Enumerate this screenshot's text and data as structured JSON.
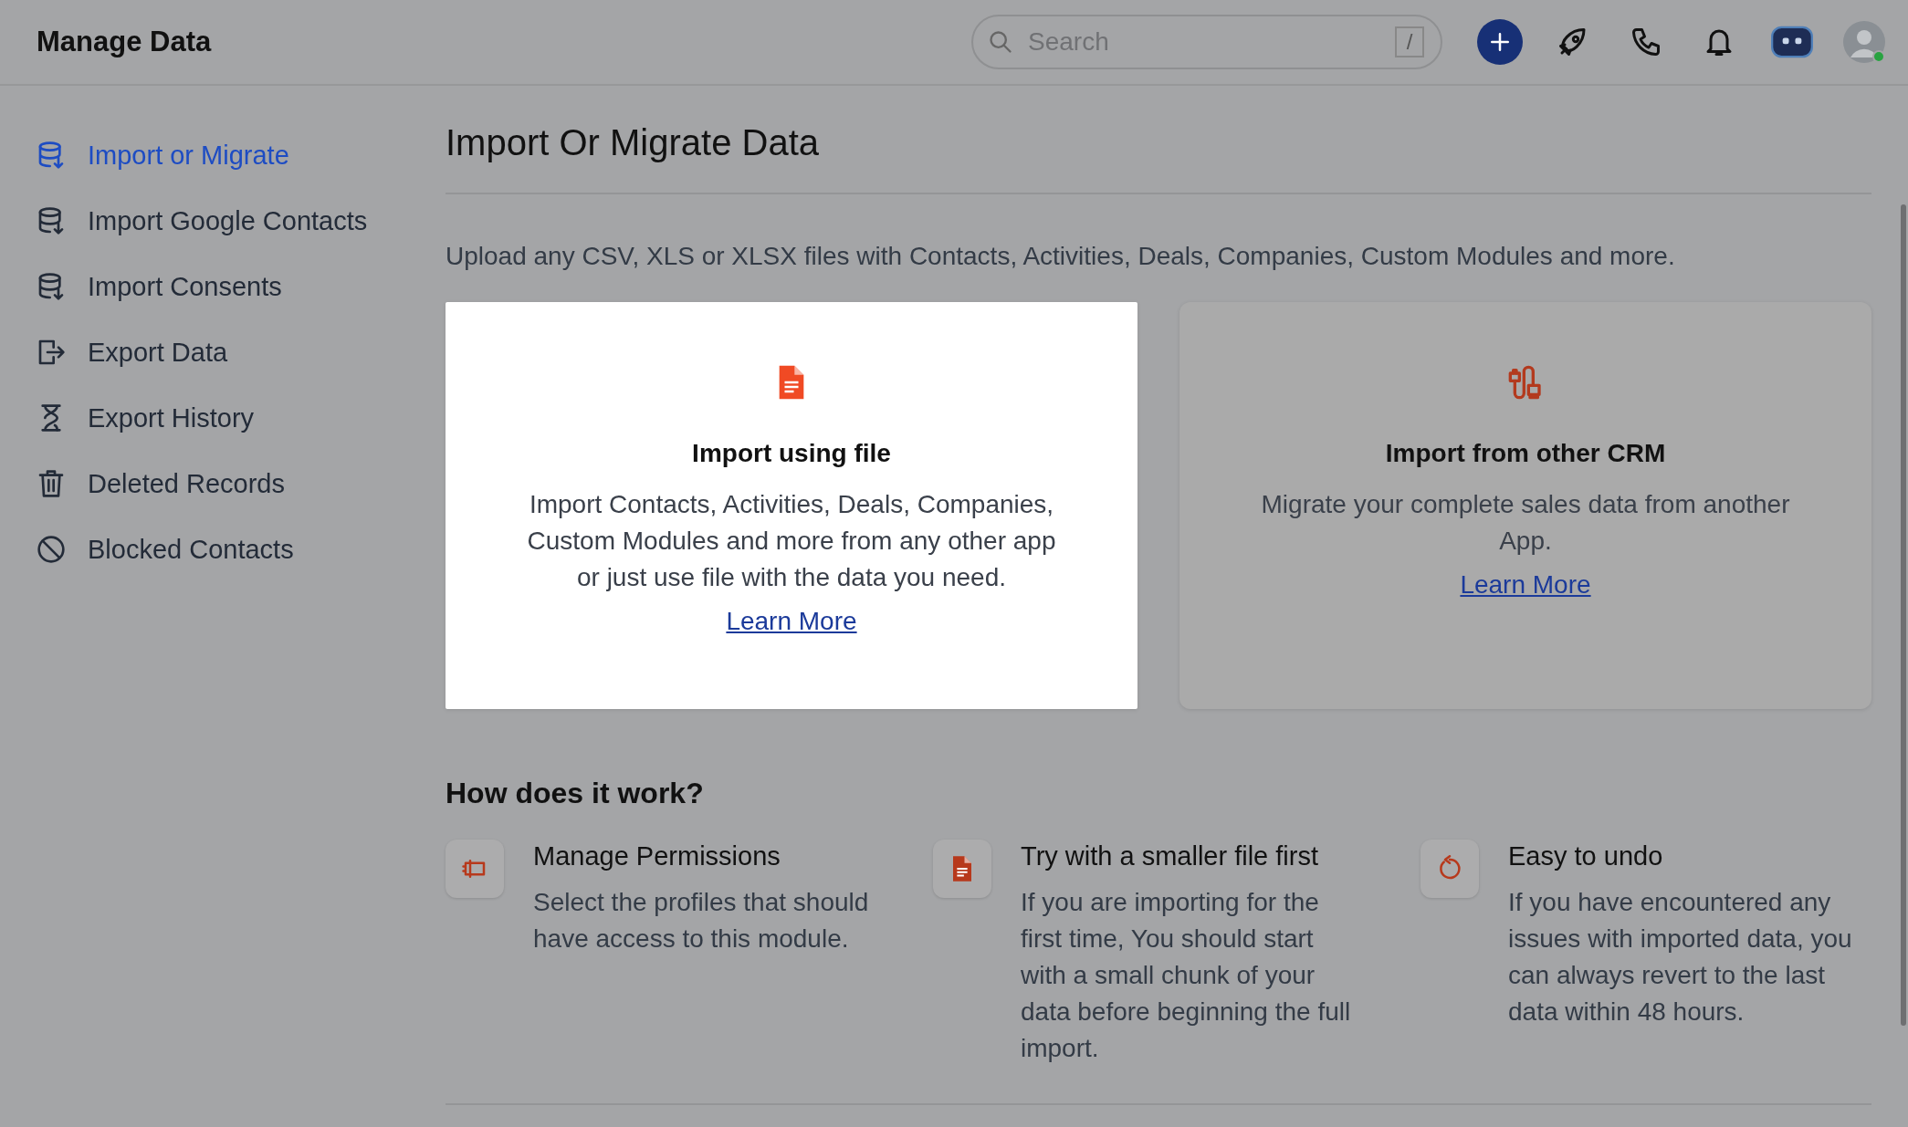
{
  "header": {
    "title": "Manage Data",
    "search": {
      "placeholder": "Search",
      "shortcut": "/"
    }
  },
  "sidebar": {
    "items": [
      {
        "label": "Import or Migrate",
        "kind": "import",
        "selected": true
      },
      {
        "label": "Import Google Contacts",
        "kind": "import",
        "selected": false
      },
      {
        "label": "Import Consents",
        "kind": "import",
        "selected": false
      },
      {
        "label": "Export Data",
        "kind": "export",
        "selected": false
      },
      {
        "label": "Export History",
        "kind": "history",
        "selected": false
      },
      {
        "label": "Deleted Records",
        "kind": "deleted",
        "selected": false
      },
      {
        "label": "Blocked Contacts",
        "kind": "blocked",
        "selected": false
      }
    ]
  },
  "main": {
    "title": "Import Or Migrate Data",
    "description": "Upload any CSV, XLS or XLSX files with Contacts, Activities, Deals, Companies, Custom Modules and more.",
    "cards": [
      {
        "kind": "file",
        "title": "Import using file",
        "text": "Import Contacts, Activities, Deals, Companies, Custom Modules and more from any other app or just use file with the data you need.",
        "link": "Learn More",
        "selected": true
      },
      {
        "kind": "crm",
        "title": "Import from other CRM",
        "text": "Migrate your complete sales data from another App.",
        "link": "Learn More",
        "selected": false
      }
    ],
    "how": {
      "title": "How does it work?",
      "steps": [
        {
          "kind": "permissions",
          "title": "Manage Permissions",
          "text": "Select the profiles that should have access to this module."
        },
        {
          "kind": "file",
          "title": "Try with a smaller file first",
          "text": "If you are importing for the first time, You should start with a small chunk of your data before beginning the full import."
        },
        {
          "kind": "undo",
          "title": "Easy to undo",
          "text": "If you have encountered any issues with imported data, you can always revert to the last data within 48 hours."
        }
      ]
    }
  }
}
